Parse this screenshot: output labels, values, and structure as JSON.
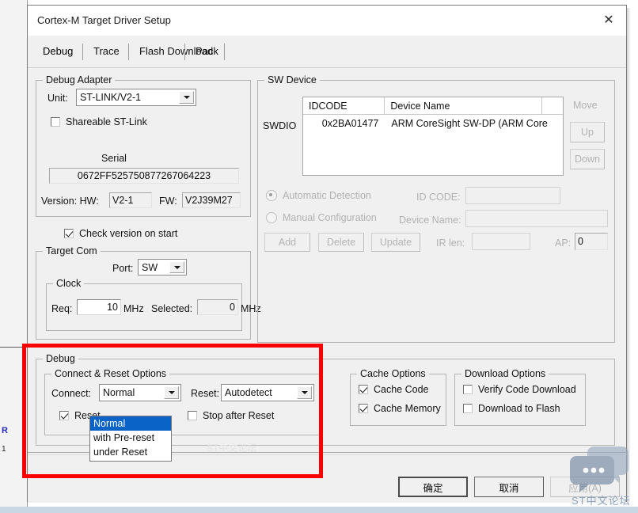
{
  "window": {
    "title": "Cortex-M Target Driver Setup",
    "close_icon": "close-icon"
  },
  "tabs": [
    {
      "label": "Debug",
      "selected": true
    },
    {
      "label": "Trace",
      "selected": false
    },
    {
      "label": "Flash Download",
      "selected": false
    },
    {
      "label": "Pack",
      "selected": false
    }
  ],
  "debug_adapter": {
    "legend": "Debug Adapter",
    "unit_label": "Unit:",
    "unit_value": "ST-LINK/V2-1",
    "shareable_label": "Shareable ST-Link",
    "shareable_checked": false,
    "serial_label": "Serial",
    "serial_value": "0672FF525750877267064223",
    "version_label": "Version: HW:",
    "hw_value": "V2-1",
    "fw_label": "FW:",
    "fw_value": "V2J39M27",
    "check_version_label": "Check version on start",
    "check_version_checked": true
  },
  "target_com": {
    "legend": "Target Com",
    "port_label": "Port:",
    "port_value": "SW",
    "clock": {
      "legend": "Clock",
      "req_label": "Req:",
      "req_value": "10",
      "req_unit": "MHz",
      "selected_label": "Selected:",
      "selected_value": "0",
      "selected_unit": "MHz"
    }
  },
  "sw_device": {
    "legend": "SW Device",
    "bus_label": "SWDIO",
    "columns": [
      "IDCODE",
      "Device Name"
    ],
    "rows": [
      {
        "idcode": "0x2BA01477",
        "device_name": "ARM CoreSight SW-DP (ARM Core"
      }
    ],
    "move_label": "Move",
    "up_label": "Up",
    "down_label": "Down",
    "automatic_detection_label": "Automatic Detection",
    "manual_configuration_label": "Manual Configuration",
    "detection_mode": "automatic",
    "id_code_label": "ID CODE:",
    "id_code_value": "",
    "device_name_label": "Device Name:",
    "device_name_value": "",
    "ir_len_label": "IR len:",
    "ir_len_value": "",
    "ap_label": "AP:",
    "ap_value": "0",
    "add_label": "Add",
    "delete_label": "Delete",
    "update_label": "Update"
  },
  "debug_section": {
    "legend": "Debug",
    "connect_reset": {
      "legend": "Connect & Reset Options",
      "connect_label": "Connect:",
      "connect_value": "Normal",
      "connect_options": [
        "Normal",
        "with Pre-reset",
        "under Reset"
      ],
      "connect_selected_index": 0,
      "reset_label": "Reset:",
      "reset_value": "Autodetect",
      "reset_after_connect_label": "Reset",
      "reset_after_connect_checked": true,
      "stop_after_reset_label": "Stop after Reset",
      "stop_after_reset_checked": false
    },
    "cache_options": {
      "legend": "Cache Options",
      "cache_code_label": "Cache Code",
      "cache_code_checked": true,
      "cache_memory_label": "Cache Memory",
      "cache_memory_checked": true
    },
    "download_options": {
      "legend": "Download Options",
      "verify_code_label": "Verify Code Download",
      "verify_code_checked": false,
      "download_flash_label": "Download to Flash",
      "download_flash_checked": false
    }
  },
  "footer": {
    "ok_label": "确定",
    "cancel_label": "取消",
    "apply_label": "应用(A)",
    "apply_disabled": true
  },
  "annotation": {
    "highlight_color": "#fb0000"
  },
  "watermarks": {
    "faint_text": "ST中文论坛",
    "corner_text": "ST中文论坛",
    "bubble_icon": "chat-bubble-icon"
  },
  "background_app": {
    "line1": "",
    "line2": "R",
    "line3": "1"
  }
}
